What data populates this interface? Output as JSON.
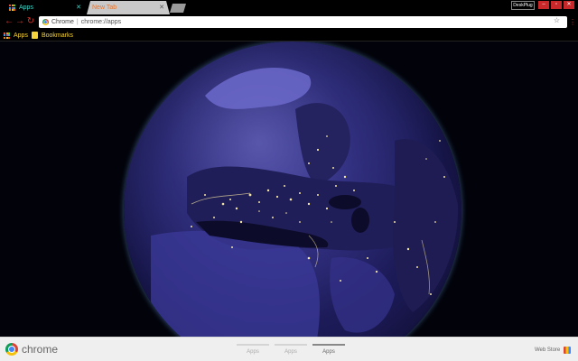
{
  "tabs": [
    {
      "label": "Apps",
      "active": true,
      "color": "#3fd6c9"
    },
    {
      "label": "New Tab",
      "active": false,
      "color": "#e8762f"
    }
  ],
  "window": {
    "profile_label": "DeskPlug",
    "accent_color": "#c8282a"
  },
  "toolbar": {
    "omnibox_scheme_label": "Chrome",
    "url": "chrome://apps"
  },
  "bookmarks": {
    "apps_label": "Apps",
    "folder_label": "Bookmarks"
  },
  "footer": {
    "brand": "chrome",
    "pages": [
      {
        "label": "Apps",
        "active": false
      },
      {
        "label": "Apps",
        "active": false
      },
      {
        "label": "Apps",
        "active": true
      }
    ],
    "webstore_label": "Web Store"
  },
  "icons": {
    "apps_grid_colors": [
      "#e84c3d",
      "#f39c12",
      "#2ecc71",
      "#3498db",
      "#9b59b6",
      "#1abc9c",
      "#e67e22",
      "#f1c40f",
      "#e74c3c"
    ]
  }
}
